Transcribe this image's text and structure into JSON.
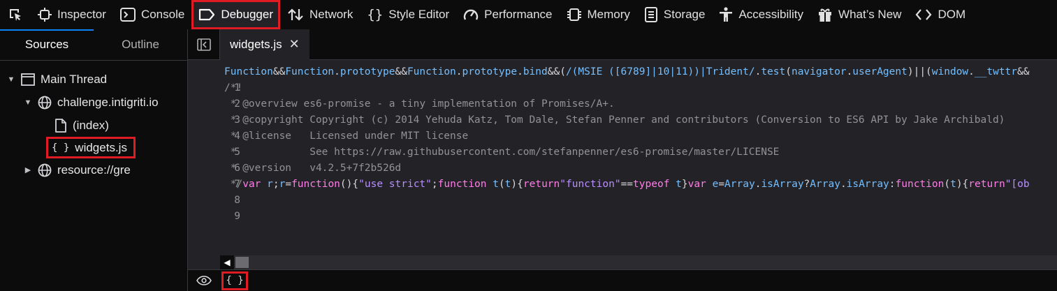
{
  "toolbar": {
    "tabs": [
      {
        "label": "Inspector",
        "icon": "inspector-icon"
      },
      {
        "label": "Console",
        "icon": "console-icon"
      },
      {
        "label": "Debugger",
        "icon": "debugger-icon",
        "active": true
      },
      {
        "label": "Network",
        "icon": "network-icon"
      },
      {
        "label": "Style Editor",
        "icon": "style-editor-icon"
      },
      {
        "label": "Performance",
        "icon": "performance-icon"
      },
      {
        "label": "Memory",
        "icon": "memory-icon"
      },
      {
        "label": "Storage",
        "icon": "storage-icon"
      },
      {
        "label": "Accessibility",
        "icon": "accessibility-icon"
      },
      {
        "label": "What’s New",
        "icon": "gift-icon"
      },
      {
        "label": "DOM",
        "icon": "dom-icon"
      }
    ]
  },
  "sidebar": {
    "tabs": [
      "Sources",
      "Outline"
    ],
    "tree": {
      "thread": "Main Thread",
      "domain": "challenge.intigriti.io",
      "index": "(index)",
      "file": "widgets.js",
      "resource": "resource://gre",
      "braces": "{ }"
    }
  },
  "editor": {
    "tab_label": "widgets.js",
    "close": "✕",
    "line_numbers": [
      "1",
      "2",
      "3",
      "4",
      "5",
      "6",
      "7",
      "8",
      "9"
    ],
    "lines": {
      "l2": "/*!",
      "l3": " * @overview es6-promise - a tiny implementation of Promises/A+.",
      "l4": " * @copyright Copyright (c) 2014 Yehuda Katz, Tom Dale, Stefan Penner and contributors (Conversion to ES6 API by Jake Archibald)",
      "l5": " * @license   Licensed under MIT license",
      "l6": " *            See https://raw.githubusercontent.com/stefanpenner/es6-promise/master/LICENSE",
      "l7": " * @version   v4.2.5+7f2b526d"
    }
  },
  "footer": {
    "pretty_print": "{ }"
  },
  "colors": {
    "accent": "#0a84ff",
    "highlight": "#e01b24"
  }
}
